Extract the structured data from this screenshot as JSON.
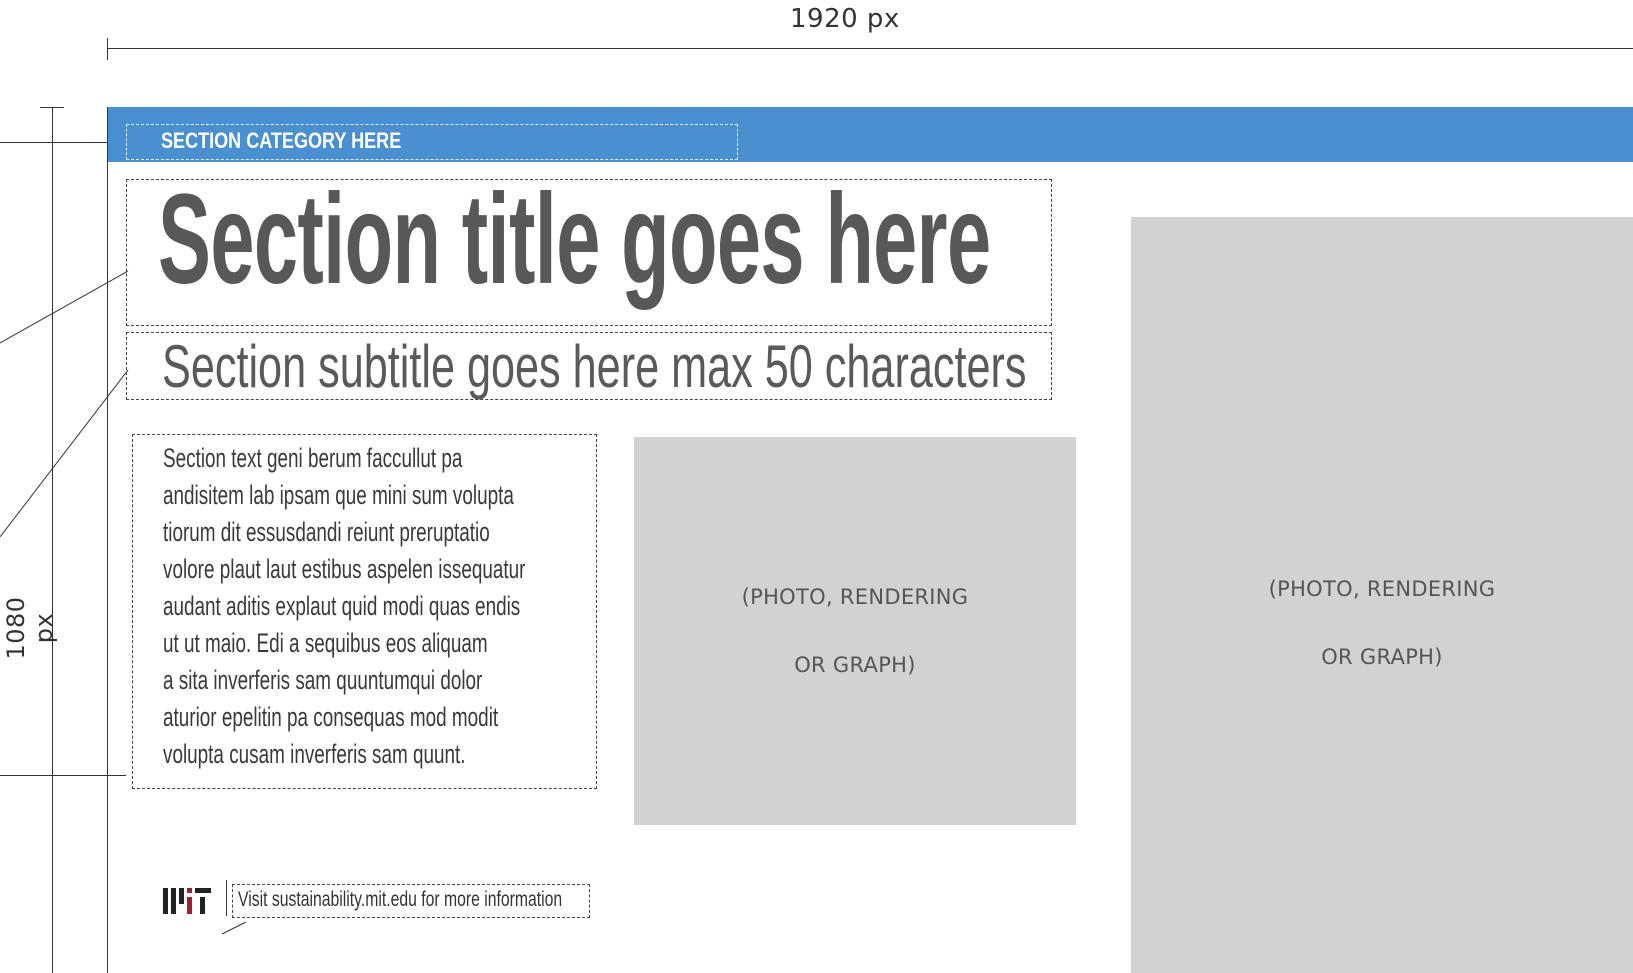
{
  "dimensions": {
    "width_label": "1920 px",
    "height_label": "1080 px"
  },
  "banner": {
    "category": "SECTION CATEGORY HERE",
    "color": "#4a8fd0"
  },
  "section": {
    "title": "Section title goes here",
    "subtitle": "Section subtitle goes here max 50 characters",
    "text_lines": [
      "Section text geni berum faccullut pa",
      "andisitem lab ipsam que mini sum volupta",
      "tiorum dit essusdandi reiunt preruptatio",
      "volore plaut laut estibus aspelen issequatur",
      "audant aditis explaut quid modi quas endis",
      "ut ut maio. Edi a sequibus eos aliquam",
      "a sita inverferis sam quuntumqui dolor",
      "aturior epelitin pa consequas mod modit",
      "volupta cusam inverferis sam quunt."
    ]
  },
  "media": {
    "photo_1": {
      "line1": "(PHOTO, RENDERING",
      "line2": "OR GRAPH)"
    },
    "photo_2": {
      "line1": "(PHOTO, RENDERING",
      "line2": "OR GRAPH)"
    },
    "placeholder_color": "#d1d2d4"
  },
  "footer": {
    "logo_icon": "mit-logo-icon",
    "link_text": "Visit sustainability.mit.edu for more information"
  }
}
